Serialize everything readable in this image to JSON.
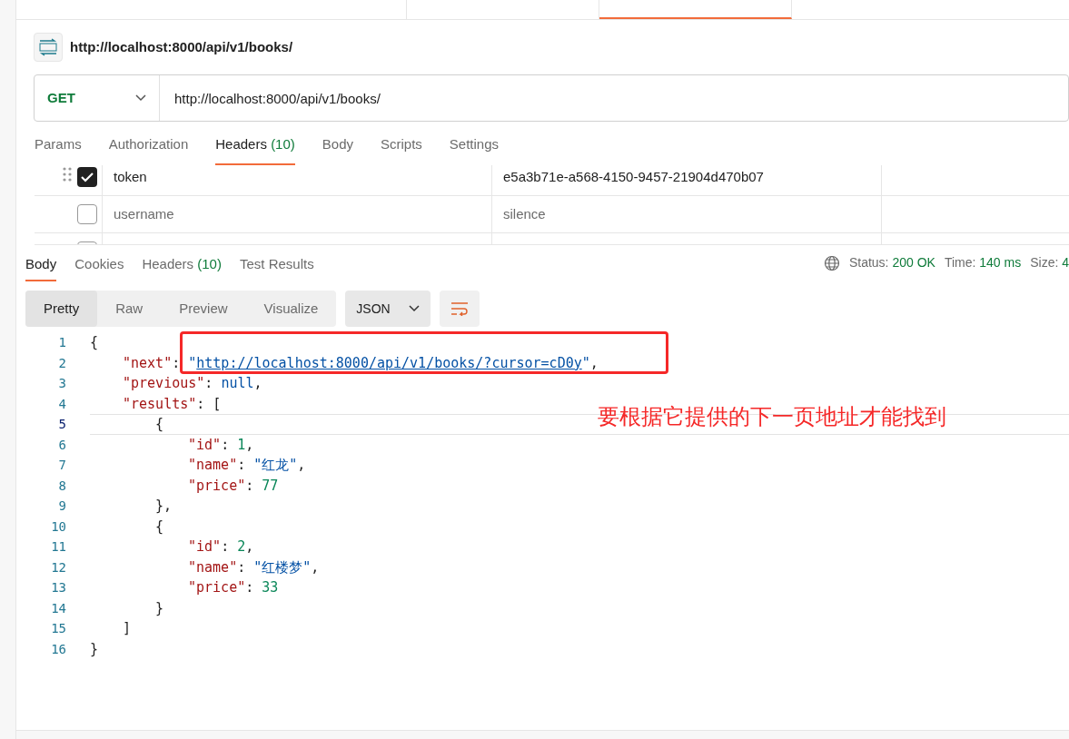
{
  "request_tabs": [
    {
      "selected": false
    },
    {
      "selected": false
    },
    {
      "selected": true
    }
  ],
  "request": {
    "title": "http://localhost:8000/api/v1/books/",
    "method": "GET",
    "url": "http://localhost:8000/api/v1/books/"
  },
  "request_tabs_row": [
    {
      "label": "Params",
      "selected": false
    },
    {
      "label": "Authorization",
      "selected": false
    },
    {
      "label": "Headers",
      "count": "(10)",
      "selected": true
    },
    {
      "label": "Body",
      "selected": false
    },
    {
      "label": "Scripts",
      "selected": false
    },
    {
      "label": "Settings",
      "selected": false
    }
  ],
  "headers": [
    {
      "checked": true,
      "key": "token",
      "value": "e5a3b71e-a568-4150-9457-21904d470b07"
    },
    {
      "checked": false,
      "key": "username",
      "value": "silence"
    },
    {
      "checked": false
    }
  ],
  "response_tabs": [
    {
      "label": "Body",
      "selected": true
    },
    {
      "label": "Cookies",
      "selected": false
    },
    {
      "label": "Headers",
      "count": "(10)",
      "selected": false
    },
    {
      "label": "Test Results",
      "selected": false
    }
  ],
  "status": {
    "status_label": "Status:",
    "status_value": "200 OK",
    "time_label": "Time:",
    "time_value": "140 ms",
    "size_label": "Size:",
    "size_value": "4"
  },
  "view_modes": [
    {
      "label": "Pretty",
      "selected": true
    },
    {
      "label": "Raw",
      "selected": false
    },
    {
      "label": "Preview",
      "selected": false
    },
    {
      "label": "Visualize",
      "selected": false
    }
  ],
  "format": "JSON",
  "code_lines": [
    {
      "number": "1",
      "current": false,
      "tokens": [
        {
          "kind": "open",
          "text": "{"
        }
      ]
    },
    {
      "number": "2",
      "current": false,
      "tokens": [
        {
          "kind": "key",
          "text": "\"next\""
        },
        {
          "kind": "punct",
          "text": ": "
        },
        {
          "kind": "string",
          "text": "\""
        },
        {
          "kind": "link",
          "text": "http://localhost:8000/api/v1/books/?cursor=cD0y"
        },
        {
          "kind": "string",
          "text": "\""
        },
        {
          "kind": "punct",
          "text": ","
        }
      ]
    },
    {
      "number": "3",
      "current": false,
      "tokens": [
        {
          "kind": "key",
          "text": "\"previous\""
        },
        {
          "kind": "punct",
          "text": ": "
        },
        {
          "kind": "null",
          "text": "null"
        },
        {
          "kind": "punct",
          "text": ","
        }
      ]
    },
    {
      "number": "4",
      "current": false,
      "tokens": [
        {
          "kind": "key",
          "text": "\"results\""
        },
        {
          "kind": "punct",
          "text": ": "
        },
        {
          "kind": "open",
          "text": "["
        }
      ]
    },
    {
      "number": "5",
      "current": true,
      "tokens": [
        {
          "kind": "open",
          "text": "{"
        }
      ]
    },
    {
      "number": "6",
      "current": false,
      "tokens": [
        {
          "kind": "key",
          "text": "\"id\""
        },
        {
          "kind": "punct",
          "text": ": "
        },
        {
          "kind": "number",
          "text": "1"
        },
        {
          "kind": "punct",
          "text": ","
        }
      ]
    },
    {
      "number": "7",
      "current": false,
      "tokens": [
        {
          "kind": "key",
          "text": "\"name\""
        },
        {
          "kind": "punct",
          "text": ": "
        },
        {
          "kind": "string",
          "text": "\"红龙\""
        },
        {
          "kind": "punct",
          "text": ","
        }
      ]
    },
    {
      "number": "8",
      "current": false,
      "tokens": [
        {
          "kind": "key",
          "text": "\"price\""
        },
        {
          "kind": "punct",
          "text": ": "
        },
        {
          "kind": "number",
          "text": "77"
        }
      ]
    },
    {
      "number": "9",
      "current": false,
      "tokens": [
        {
          "kind": "close",
          "text": "}"
        },
        {
          "kind": "punct",
          "text": ","
        }
      ]
    },
    {
      "number": "10",
      "current": false,
      "tokens": [
        {
          "kind": "open",
          "text": "{"
        }
      ]
    },
    {
      "number": "11",
      "current": false,
      "tokens": [
        {
          "kind": "key",
          "text": "\"id\""
        },
        {
          "kind": "punct",
          "text": ": "
        },
        {
          "kind": "number",
          "text": "2"
        },
        {
          "kind": "punct",
          "text": ","
        }
      ]
    },
    {
      "number": "12",
      "current": false,
      "tokens": [
        {
          "kind": "key",
          "text": "\"name\""
        },
        {
          "kind": "punct",
          "text": ": "
        },
        {
          "kind": "string",
          "text": "\"红楼梦\""
        },
        {
          "kind": "punct",
          "text": ","
        }
      ]
    },
    {
      "number": "13",
      "current": false,
      "tokens": [
        {
          "kind": "key",
          "text": "\"price\""
        },
        {
          "kind": "punct",
          "text": ": "
        },
        {
          "kind": "number",
          "text": "33"
        }
      ]
    },
    {
      "number": "14",
      "current": false,
      "tokens": [
        {
          "kind": "close",
          "text": "}"
        }
      ]
    },
    {
      "number": "15",
      "current": false,
      "tokens": [
        {
          "kind": "close",
          "text": "]"
        }
      ]
    },
    {
      "number": "16",
      "current": false,
      "tokens": [
        {
          "kind": "close",
          "text": "}"
        }
      ]
    }
  ],
  "annotation": {
    "text": "要根据它提供的下一页地址才能找到"
  }
}
